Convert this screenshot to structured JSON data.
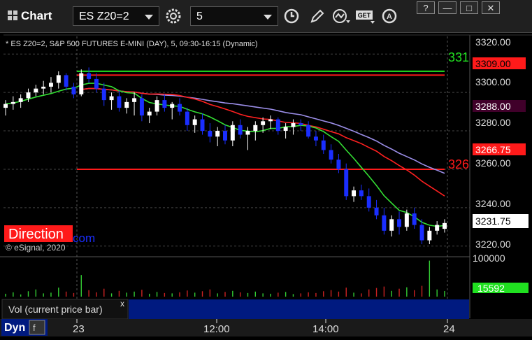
{
  "toolbar": {
    "app_label": "Chart",
    "symbol": "ES Z20=2",
    "interval": "5",
    "window_buttons": [
      "?",
      "—",
      "□",
      "✕"
    ]
  },
  "chart": {
    "header": "* ES Z20=2, S&P 500 FUTURES E-MINI (DAY), 5, 09:30-16:15 (Dynamic)",
    "price_ticks": [
      "3320.00",
      "3300.00",
      "3280.00",
      "3260.00",
      "3240.00",
      "3220.00"
    ],
    "tags": {
      "red_level_high": "3309.00",
      "ma_slow": "3288.00",
      "red_level_low": "3266.75",
      "last_price": "3231.75"
    },
    "line_labels": {
      "green": "331",
      "red": "326"
    },
    "direction_label": "Direction",
    "watermark_suffix": "com",
    "copyright": "© eSignal, 2020",
    "volume_tick": "100000",
    "volume_tag": "15592",
    "volume_label": "Vol (current price bar)",
    "close_mark": "x",
    "time_ticks": [
      "23",
      "12:00",
      "14:00",
      "24"
    ],
    "dyn_label": "Dyn"
  },
  "colors": {
    "up": "#ffffff",
    "down": "#1a2eff",
    "green_line": "#20e020",
    "red_line": "#ff1a1a",
    "ma_fast": "#ff2020",
    "ma_slow": "#9b8ee8",
    "ma_green": "#33dd33",
    "panel_blue": "#001a80"
  },
  "chart_data": {
    "type": "candlestick",
    "symbol": "ES Z20=2",
    "interval": "5",
    "y_range": [
      3217,
      3327
    ],
    "horizontal_levels": [
      {
        "value": 3311,
        "color": "green"
      },
      {
        "value": 3309,
        "color": "red"
      },
      {
        "value": 3260,
        "color": "red"
      }
    ],
    "last_price": 3231.75,
    "candles": [
      [
        3292,
        3296,
        3288,
        3294
      ],
      [
        3294,
        3298,
        3291,
        3295
      ],
      [
        3295,
        3299,
        3292,
        3297
      ],
      [
        3297,
        3302,
        3295,
        3300
      ],
      [
        3300,
        3304,
        3298,
        3302
      ],
      [
        3302,
        3306,
        3299,
        3303
      ],
      [
        3303,
        3308,
        3300,
        3305
      ],
      [
        3305,
        3311,
        3302,
        3309
      ],
      [
        3309,
        3310,
        3301,
        3303
      ],
      [
        3303,
        3305,
        3297,
        3299
      ],
      [
        3299,
        3312,
        3298,
        3310
      ],
      [
        3310,
        3313,
        3305,
        3307
      ],
      [
        3307,
        3310,
        3300,
        3302
      ],
      [
        3302,
        3305,
        3293,
        3296
      ],
      [
        3296,
        3300,
        3291,
        3298
      ],
      [
        3298,
        3301,
        3290,
        3292
      ],
      [
        3292,
        3297,
        3289,
        3295
      ],
      [
        3295,
        3300,
        3288,
        3297
      ],
      [
        3297,
        3299,
        3285,
        3288
      ],
      [
        3288,
        3292,
        3284,
        3290
      ],
      [
        3290,
        3298,
        3288,
        3296
      ],
      [
        3296,
        3299,
        3290,
        3292
      ],
      [
        3292,
        3295,
        3286,
        3294
      ],
      [
        3294,
        3297,
        3288,
        3290
      ],
      [
        3290,
        3292,
        3280,
        3283
      ],
      [
        3283,
        3288,
        3279,
        3286
      ],
      [
        3286,
        3289,
        3278,
        3280
      ],
      [
        3280,
        3284,
        3274,
        3277
      ],
      [
        3277,
        3282,
        3272,
        3280
      ],
      [
        3280,
        3283,
        3273,
        3275
      ],
      [
        3275,
        3285,
        3272,
        3283
      ],
      [
        3283,
        3286,
        3276,
        3278
      ],
      [
        3278,
        3282,
        3270,
        3280
      ],
      [
        3280,
        3285,
        3275,
        3283
      ],
      [
        3283,
        3287,
        3279,
        3285
      ],
      [
        3285,
        3288,
        3281,
        3286
      ],
      [
        3286,
        3287,
        3278,
        3280
      ],
      [
        3280,
        3284,
        3276,
        3282
      ],
      [
        3282,
        3286,
        3278,
        3284
      ],
      [
        3284,
        3286,
        3280,
        3283
      ],
      [
        3283,
        3285,
        3276,
        3277
      ],
      [
        3277,
        3280,
        3272,
        3275
      ],
      [
        3275,
        3278,
        3268,
        3270
      ],
      [
        3270,
        3273,
        3263,
        3265
      ],
      [
        3265,
        3268,
        3258,
        3260
      ],
      [
        3260,
        3263,
        3244,
        3246
      ],
      [
        3246,
        3251,
        3243,
        3249
      ],
      [
        3249,
        3252,
        3244,
        3246
      ],
      [
        3246,
        3250,
        3238,
        3240
      ],
      [
        3240,
        3244,
        3234,
        3236
      ],
      [
        3236,
        3240,
        3226,
        3228
      ],
      [
        3228,
        3236,
        3225,
        3234
      ],
      [
        3234,
        3238,
        3226,
        3230
      ],
      [
        3230,
        3239,
        3228,
        3237
      ],
      [
        3237,
        3240,
        3229,
        3231
      ],
      [
        3231,
        3234,
        3221,
        3223
      ],
      [
        3223,
        3230,
        3221,
        3228
      ],
      [
        3228,
        3233,
        3226,
        3231
      ],
      [
        3229,
        3234,
        3227,
        3232
      ]
    ],
    "volume_range": [
      0,
      105000
    ],
    "volume": [
      8000,
      12000,
      6000,
      15000,
      20000,
      9000,
      11000,
      25000,
      14000,
      10000,
      60000,
      18000,
      12000,
      22000,
      9000,
      16000,
      11000,
      14000,
      19000,
      8000,
      13000,
      10000,
      9000,
      12000,
      17000,
      11000,
      15000,
      20000,
      9000,
      13000,
      16000,
      12000,
      10000,
      14000,
      9000,
      8000,
      11000,
      13000,
      7000,
      9000,
      12000,
      10000,
      15000,
      18000,
      14000,
      25000,
      11000,
      9000,
      20000,
      24000,
      28000,
      16000,
      22000,
      26000,
      18000,
      30000,
      100000,
      20000,
      15592
    ],
    "time_ticks": [
      "23",
      "12:00",
      "14:00",
      "24"
    ]
  }
}
